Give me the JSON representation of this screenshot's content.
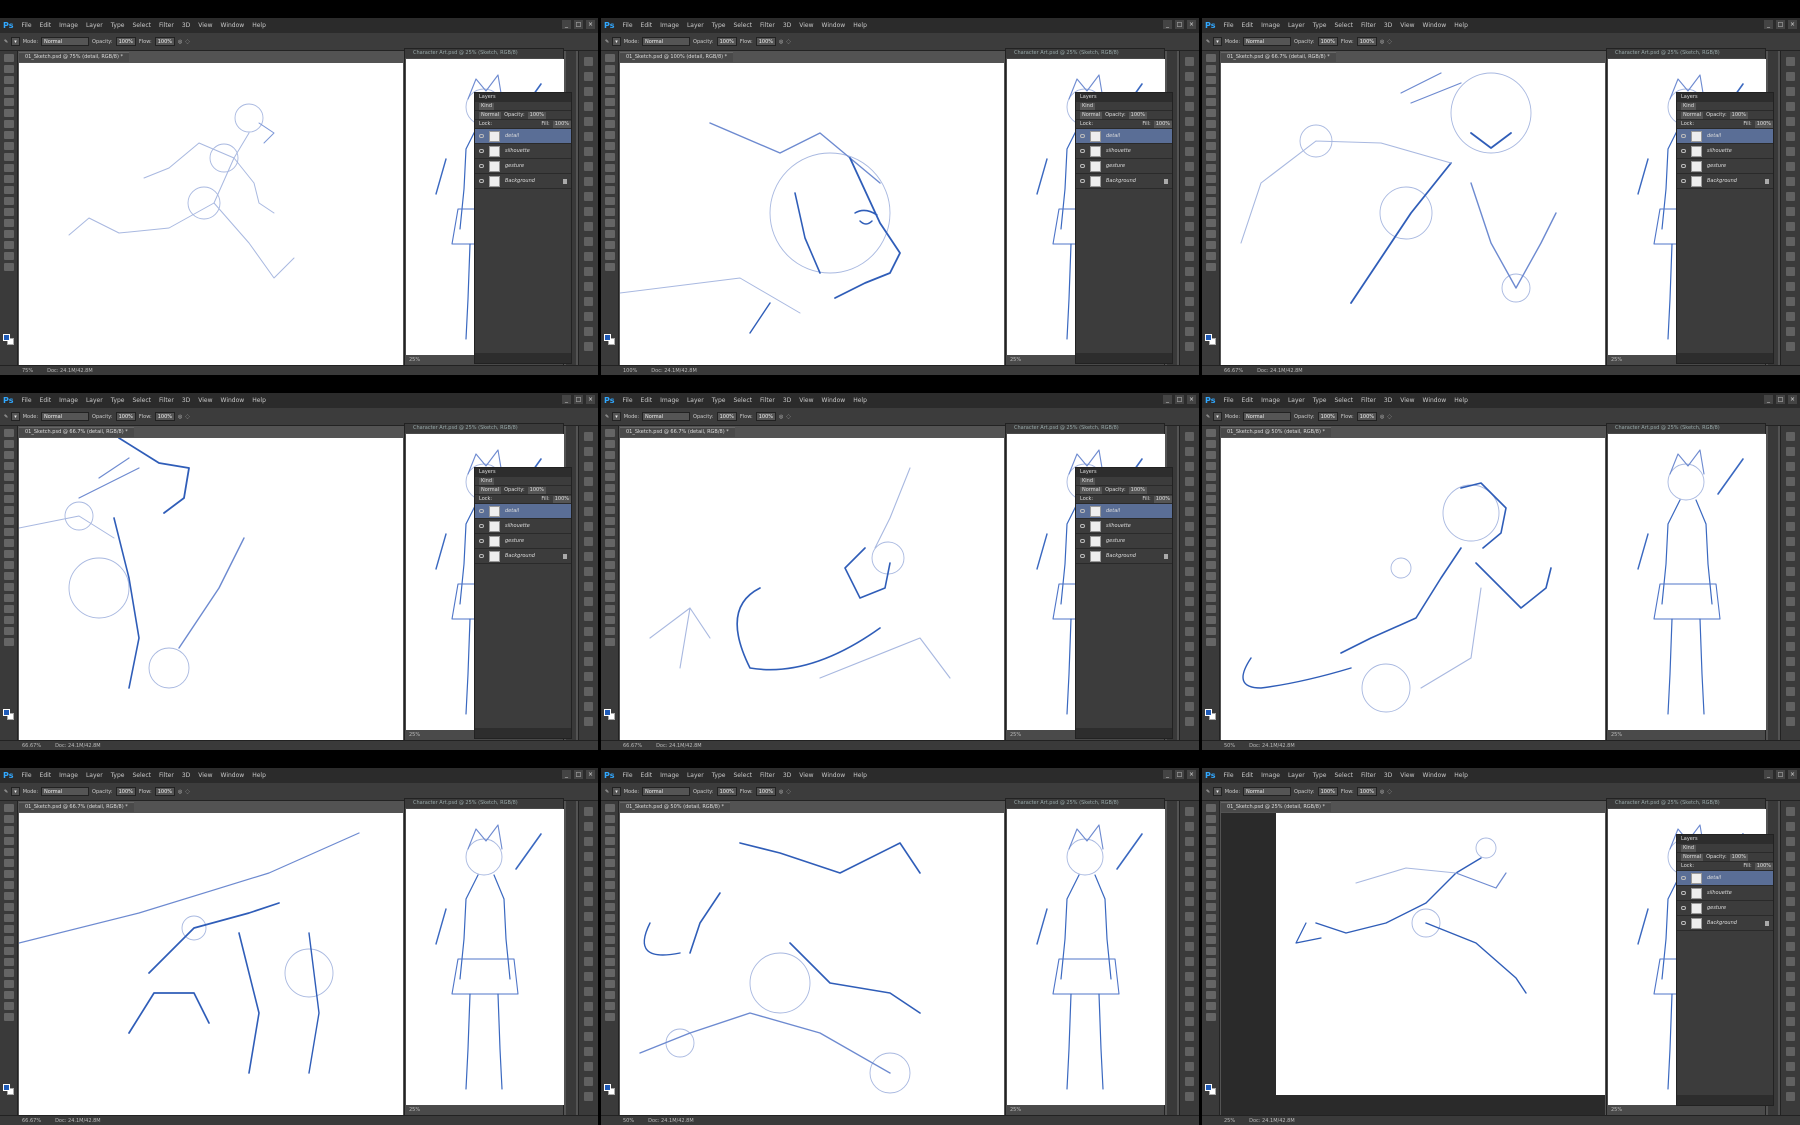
{
  "ui": {
    "app_logo": "Ps",
    "menu": [
      "File",
      "Edit",
      "Image",
      "Layer",
      "Type",
      "Select",
      "Filter",
      "3D",
      "View",
      "Window",
      "Help"
    ],
    "options": {
      "mode_label": "Mode:",
      "mode_value": "Normal",
      "opacity_label": "Opacity:",
      "opacity_value": "100%",
      "flow_label": "Flow:",
      "flow_value": "100%"
    },
    "reference_title": "Character Art.psd @ 25% (Sketch, RGB/8)",
    "reference_zoom": "25%",
    "layers": {
      "panel_title": "Layers",
      "kind_label": "Kind",
      "blend": "Normal",
      "opacity_label": "Opacity:",
      "opacity": "100%",
      "lock_label": "Lock:",
      "fill_label": "Fill:",
      "fill": "100%",
      "items": [
        "detail",
        "silhouette",
        "gesture",
        "Background"
      ]
    },
    "accent_color": "#1f5bb8",
    "selected_layer_color": "#5a6e96"
  },
  "panels": [
    {
      "doc_tab": "01_Sketch.psd @ 75% (detail, RGB/8) *",
      "zoom": "75%",
      "doc_info": "Doc: 24.1M/42.8M",
      "show_layers": true,
      "scene": "gesture-full"
    },
    {
      "doc_tab": "01_Sketch.psd @ 100% (detail, RGB/8) *",
      "zoom": "100%",
      "doc_info": "Doc: 24.1M/42.8M",
      "show_layers": true,
      "scene": "head-close"
    },
    {
      "doc_tab": "01_Sketch.psd @ 66.7% (detail, RGB/8) *",
      "zoom": "66.67%",
      "doc_info": "Doc: 24.1M/42.8M",
      "show_layers": true,
      "scene": "upper-body"
    },
    {
      "doc_tab": "01_Sketch.psd @ 66.7% (detail, RGB/8) *",
      "zoom": "66.67%",
      "doc_info": "Doc: 24.1M/42.8M",
      "show_layers": true,
      "scene": "upper-body-arm"
    },
    {
      "doc_tab": "01_Sketch.psd @ 66.7% (detail, RGB/8) *",
      "zoom": "66.67%",
      "doc_info": "Doc: 24.1M/42.8M",
      "show_layers": true,
      "scene": "fist-cape"
    },
    {
      "doc_tab": "01_Sketch.psd @ 50% (detail, RGB/8) *",
      "zoom": "50%",
      "doc_info": "Doc: 24.1M/42.8M",
      "show_layers": false,
      "scene": "running-mid"
    },
    {
      "doc_tab": "01_Sketch.psd @ 66.7% (detail, RGB/8) *",
      "zoom": "66.67%",
      "doc_info": "Doc: 24.1M/42.8M",
      "show_layers": false,
      "scene": "torso-cape"
    },
    {
      "doc_tab": "01_Sketch.psd @ 50% (detail, RGB/8) *",
      "zoom": "50%",
      "doc_info": "Doc: 24.1M/42.8M",
      "show_layers": false,
      "scene": "torso-legs"
    },
    {
      "doc_tab": "01_Sketch.psd @ 25% (detail, RGB/8) *",
      "zoom": "25%",
      "doc_info": "Doc: 24.1M/42.8M",
      "show_layers": true,
      "scene": "full-run"
    }
  ]
}
